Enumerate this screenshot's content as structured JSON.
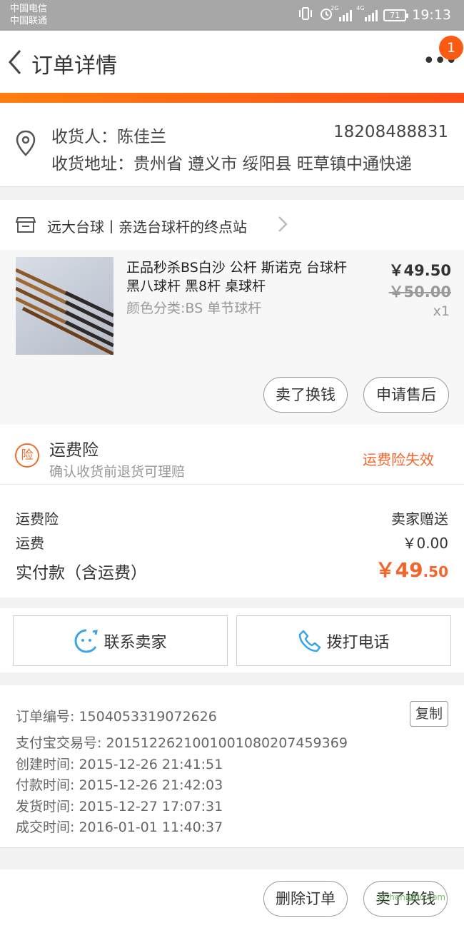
{
  "status_bar": {
    "carrier1": "中国电信",
    "carrier2": "中国联通",
    "net1": "2G",
    "net2": "4G",
    "battery": "71",
    "time": "19:13"
  },
  "nav": {
    "title": "订单详情",
    "badge": "1"
  },
  "address": {
    "receiver": "收货人：陈佳兰",
    "phone": "18208488831",
    "address": "收货地址：贵州省 遵义市 绥阳县 旺草镇中通快递"
  },
  "shop": {
    "name": "远大台球丨亲选台球杆的终点站"
  },
  "goods": {
    "title": "正品秒杀BS白沙 公杆 斯诺克 台球杆 黑八球杆 黑8杆 桌球杆",
    "sku": "颜色分类:BS 单节球杆",
    "price": "￥49.50",
    "original_price": "￥50.00",
    "quantity": "x1",
    "sell_label": "卖了换钱",
    "aftersale_label": "申请售后"
  },
  "insurance": {
    "title": "运费险",
    "desc": "确认收货前退货可理赔",
    "status": "运费险失效"
  },
  "fees": {
    "insurance_label": "运费险",
    "insurance_value": "卖家赠送",
    "shipping_label": "运费",
    "shipping_value": "￥0.00",
    "total_label": "实付款（含运费）",
    "total_main": "￥49",
    "total_decimal": ".50"
  },
  "actions": {
    "contact_label": "联系卖家",
    "call_label": "拨打电话"
  },
  "order_info": {
    "order_no": "订单编号: 1504053319072626",
    "copy_label": "复制",
    "alipay_no": "支付宝交易号: 2015122621001001080207459369",
    "created": "创建时间: 2015-12-26 21:41:51",
    "paid": "付款时间: 2015-12-26 21:42:03",
    "shipped": "发货时间: 2015-12-27 17:07:31",
    "completed": "成交时间: 2016-01-01 11:40:37"
  },
  "footer": {
    "delete_label": "删除订单",
    "sell_label": "卖了换钱"
  },
  "watermark": "JiChengXin.com",
  "colors": {
    "accent": "#f3652a",
    "badge": "#fb5a13",
    "contact_icon": "#3aa5e8"
  }
}
